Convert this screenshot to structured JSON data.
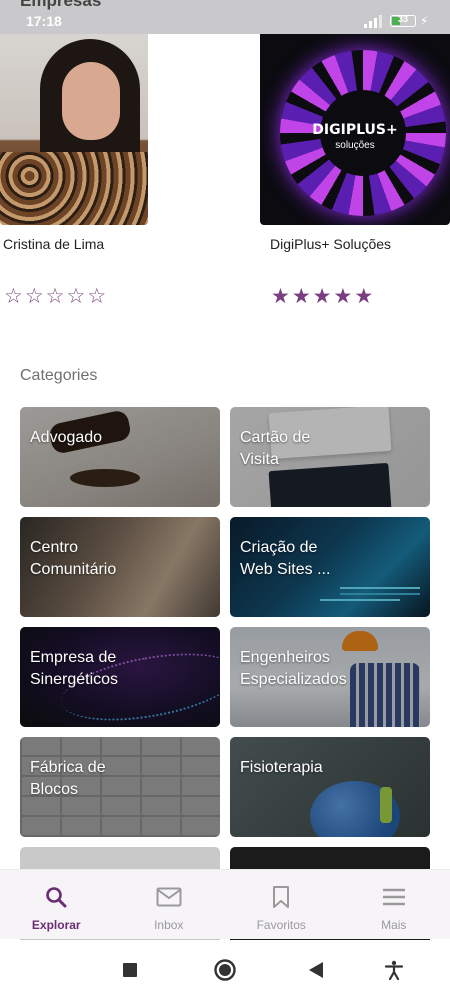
{
  "status_bar": {
    "page_heading": "Empresas",
    "time": "17:18",
    "battery_level": "33",
    "battery_fraction": 0.33
  },
  "companies": [
    {
      "name": "Cristina de Lima",
      "rating": 0,
      "max_rating": 5
    },
    {
      "name": "DigiPlus+ Soluções",
      "rating": 5,
      "max_rating": 5,
      "logo_title": "DIGIPLUS+",
      "logo_subtitle": "soluções"
    }
  ],
  "categories": {
    "heading": "Categories",
    "items": [
      {
        "label": "Advogado"
      },
      {
        "label": "Cartão de\nVisita"
      },
      {
        "label": "Centro\nComunitário"
      },
      {
        "label": "Criação de\nWeb Sites ..."
      },
      {
        "label": "Empresa de\nSinergéticos"
      },
      {
        "label": "Engenheiros\nEspecializados"
      },
      {
        "label": "Fábrica de\nBlocos"
      },
      {
        "label": "Fisioterapia"
      }
    ]
  },
  "bottom_nav": {
    "items": [
      {
        "label": "Explorar",
        "icon": "search-icon",
        "active": true
      },
      {
        "label": "Inbox",
        "icon": "mail-icon",
        "active": false
      },
      {
        "label": "Favoritos",
        "icon": "bookmark-icon",
        "active": false
      },
      {
        "label": "Mais",
        "icon": "menu-icon",
        "active": false
      }
    ]
  },
  "colors": {
    "accent": "#6a2d74",
    "star": "#7a3f80",
    "nav_background": "#f7f4f8"
  }
}
